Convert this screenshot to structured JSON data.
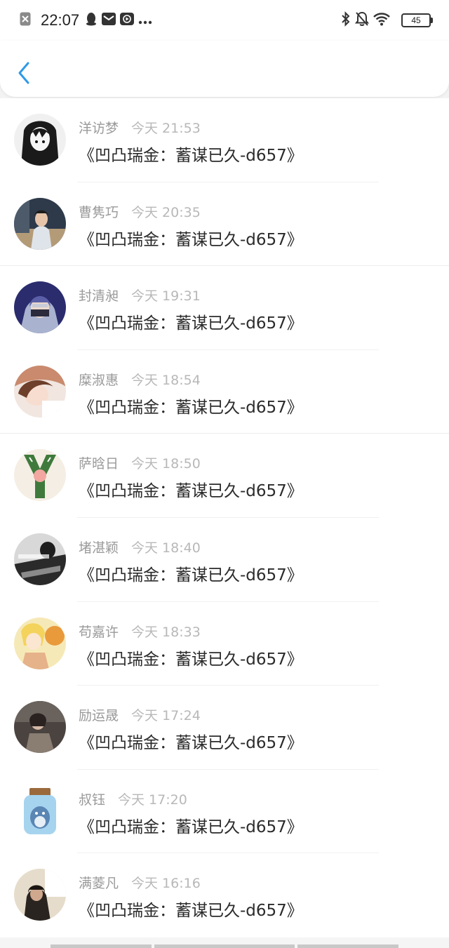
{
  "status_bar": {
    "time": "22:07",
    "battery": "45",
    "left_icons": [
      "close-box-icon",
      "qq-penguin-icon",
      "mail-icon",
      "media-icon",
      "more-dots-icon"
    ],
    "right_icons": [
      "bluetooth-icon",
      "mute-bell-icon",
      "wifi-icon",
      "battery-icon"
    ]
  },
  "nav": {
    "back_icon": "chevron-left-icon",
    "accent_color": "#2f9ae8"
  },
  "messages": [
    {
      "name": "洋访梦",
      "time": "今天 21:53",
      "text": "《凹凸瑞金：蓄谋已久-d657》"
    },
    {
      "name": "曹隽巧",
      "time": "今天 20:35",
      "text": "《凹凸瑞金：蓄谋已久-d657》"
    },
    {
      "name": "封清昶",
      "time": "今天 19:31",
      "text": "《凹凸瑞金：蓄谋已久-d657》"
    },
    {
      "name": "糜淑惠",
      "time": "今天 18:54",
      "text": "《凹凸瑞金：蓄谋已久-d657》"
    },
    {
      "name": "萨晗日",
      "time": "今天 18:50",
      "text": "《凹凸瑞金：蓄谋已久-d657》"
    },
    {
      "name": "堵湛颖",
      "time": "今天 18:40",
      "text": "《凹凸瑞金：蓄谋已久-d657》"
    },
    {
      "name": "苟嘉许",
      "time": "今天 18:33",
      "text": "《凹凸瑞金：蓄谋已久-d657》"
    },
    {
      "name": "励运晟",
      "time": "今天 17:24",
      "text": "《凹凸瑞金：蓄谋已久-d657》"
    },
    {
      "name": "叔钰",
      "time": "今天 17:20",
      "text": "《凹凸瑞金：蓄谋已久-d657》"
    },
    {
      "name": "满菱凡",
      "time": "今天 16:16",
      "text": "《凹凸瑞金：蓄谋已久-d657》"
    }
  ]
}
